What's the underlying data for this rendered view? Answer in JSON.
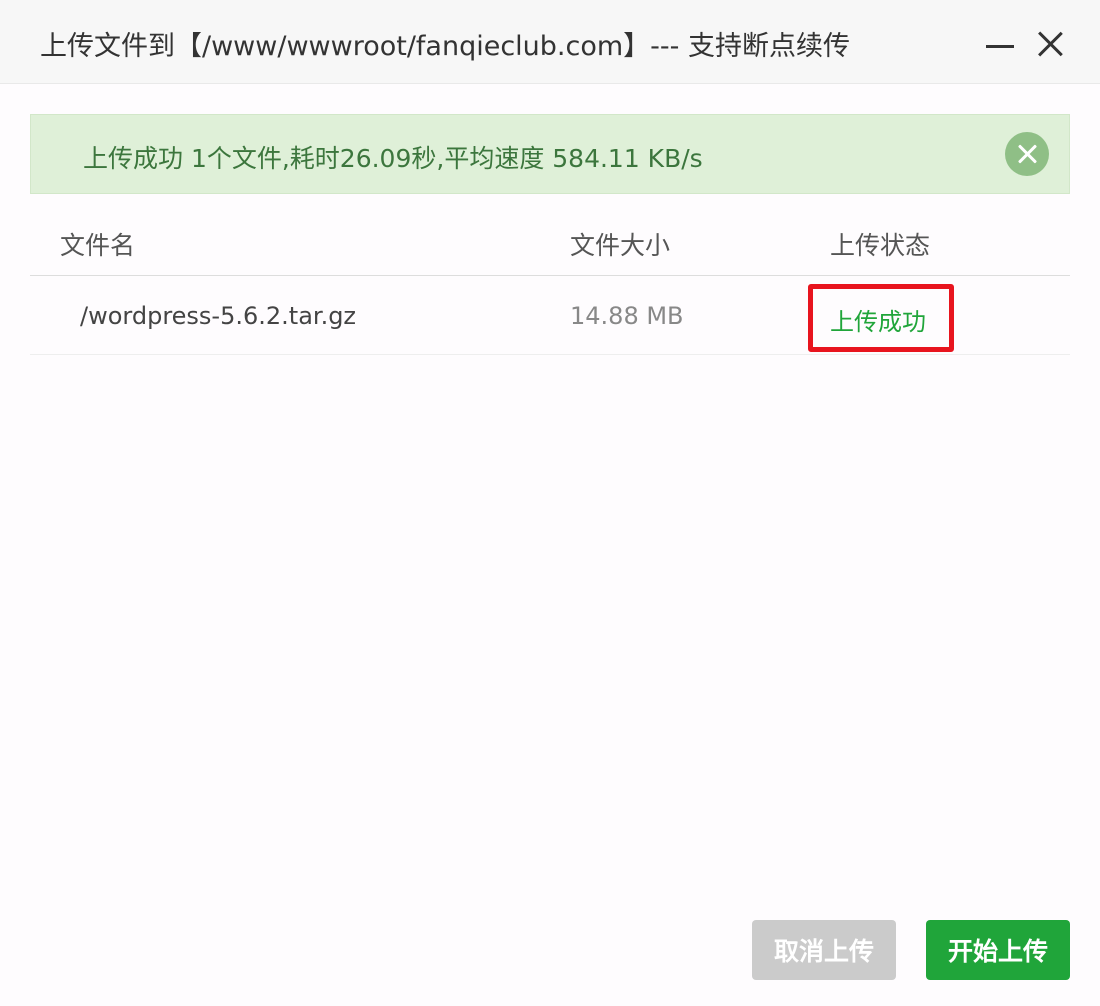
{
  "dialog": {
    "title": "上传文件到【/www/wwwroot/fanqieclub.com】--- 支持断点续传"
  },
  "alert": {
    "message": "上传成功 1个文件,耗时26.09秒,平均速度 584.11 KB/s",
    "color": "#3c763d",
    "background": "#dff0d8"
  },
  "table": {
    "headers": [
      "文件名",
      "文件大小",
      "上传状态"
    ],
    "rows": [
      {
        "name": "/wordpress-5.6.2.tar.gz",
        "size": "14.88 MB",
        "status": "上传成功"
      }
    ]
  },
  "buttons": {
    "cancel_label": "取消上传",
    "start_label": "开始上传"
  },
  "colors": {
    "accent": "#20a53a",
    "highlight_border": "#e8141e",
    "disabled": "#cbcbcb"
  },
  "icons": {
    "minimize": "minimize-icon",
    "close": "close-icon",
    "alert_close": "close-circle-icon"
  }
}
